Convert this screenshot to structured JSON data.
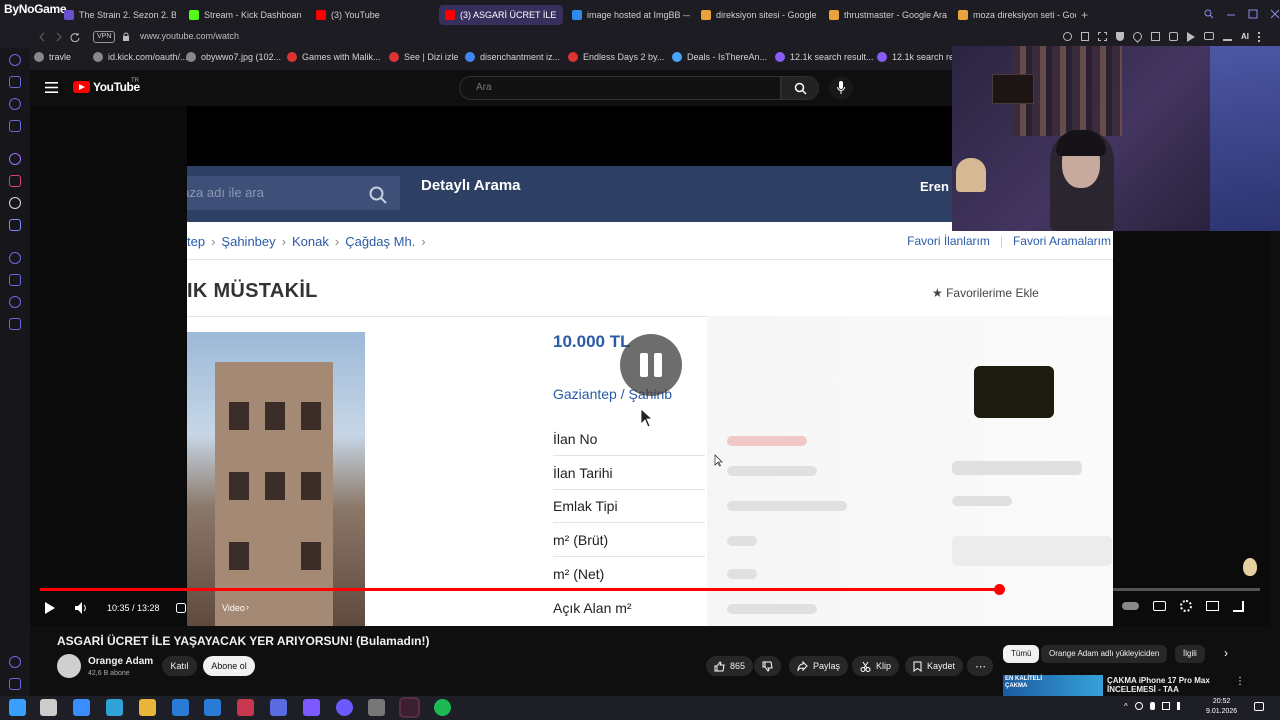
{
  "browser": {
    "brand": "ByNoGame",
    "tabs": [
      {
        "label": "The Strain 2. Sezon 2. Böl",
        "color": "#6a4fcf"
      },
      {
        "label": "Stream - Kick Dashboard",
        "color": "#53fc18"
      },
      {
        "label": "(3) YouTube",
        "color": "#ff0000"
      },
      {
        "label": "(3) ASGARİ ÜCRET İLE",
        "color": "#ff0000"
      },
      {
        "label": "image hosted at ImgBB —",
        "color": "#2d8ceb"
      },
      {
        "label": "direksiyon sitesi - Google",
        "color": "#e8a33d"
      },
      {
        "label": "thrustmaster - Google Ara",
        "color": "#e8a33d"
      },
      {
        "label": "moza direksiyon seti - Goo",
        "color": "#e8a33d"
      }
    ],
    "new_tab": "+",
    "vpn": "VPN",
    "url": "www.youtube.com/watch",
    "bookmarks": [
      {
        "label": "travle",
        "color": "#888"
      },
      {
        "label": "id.kick.com/oauth/...",
        "color": "#888"
      },
      {
        "label": "obywwo7.jpg (102...",
        "color": "#888"
      },
      {
        "label": "Games with Malik...",
        "color": "#d33"
      },
      {
        "label": "See | Dizi izle",
        "color": "#d33"
      },
      {
        "label": "disenchantment iz...",
        "color": "#4285f4"
      },
      {
        "label": "Endless Days 2 by...",
        "color": "#d33"
      },
      {
        "label": "Deals - IsThereAn...",
        "color": "#4aa3ff"
      },
      {
        "label": "12.1k search result...",
        "color": "#8a5cf6"
      },
      {
        "label": "12.1k search res",
        "color": "#8a5cf6"
      }
    ]
  },
  "youtube": {
    "logo": "YouTube",
    "region": "TR",
    "search_placeholder": "Ara"
  },
  "frame": {
    "search_text": "mağaza adı ile ara",
    "detailed_search": "Detaylı Arama",
    "user": "Eren",
    "breadcrumbs": [
      "tep",
      "Şahinbey",
      "Konak",
      "Çağdaş Mh."
    ],
    "fav_links": [
      "Favori İlanlarım",
      "Favori Aramalarım"
    ],
    "title": "IK MÜSTAKİL",
    "fav_add": "★ Favorilerime Ekle",
    "price": "10.000 TL",
    "location": "Gaziantep  /  Şahinb",
    "fields": [
      "İlan No",
      "İlan Tarihi",
      "Emlak Tipi",
      "m² (Brüt)",
      "m² (Net)",
      "Açık Alan m²"
    ]
  },
  "player": {
    "time": "10:35 / 13:28",
    "chapter": "Video",
    "progress_fraction": 0.786
  },
  "video": {
    "title": "ASGARİ ÜCRET İLE YAŞAYACAK YER ARIYORSUN! (Bulamadın!)",
    "channel": "Orange Adam",
    "subscribers": "42,6 B abone",
    "join": "Katıl",
    "subscribe": "Abone ol",
    "likes": "865",
    "share": "Paylaş",
    "clip": "Klip",
    "save": "Kaydet"
  },
  "recommendations": {
    "chips": [
      "Tümü",
      "Orange Adam adlı yükleyiciden",
      "İlgili"
    ],
    "first_thumb_text": "EN KALİTELİ ÇAKMA",
    "first_title": "ÇAKMA iPhone 17 Pro Max İNCELEMESİ - TAA"
  },
  "taskbar": {
    "time": "20:52",
    "date": "9.01.2026"
  }
}
